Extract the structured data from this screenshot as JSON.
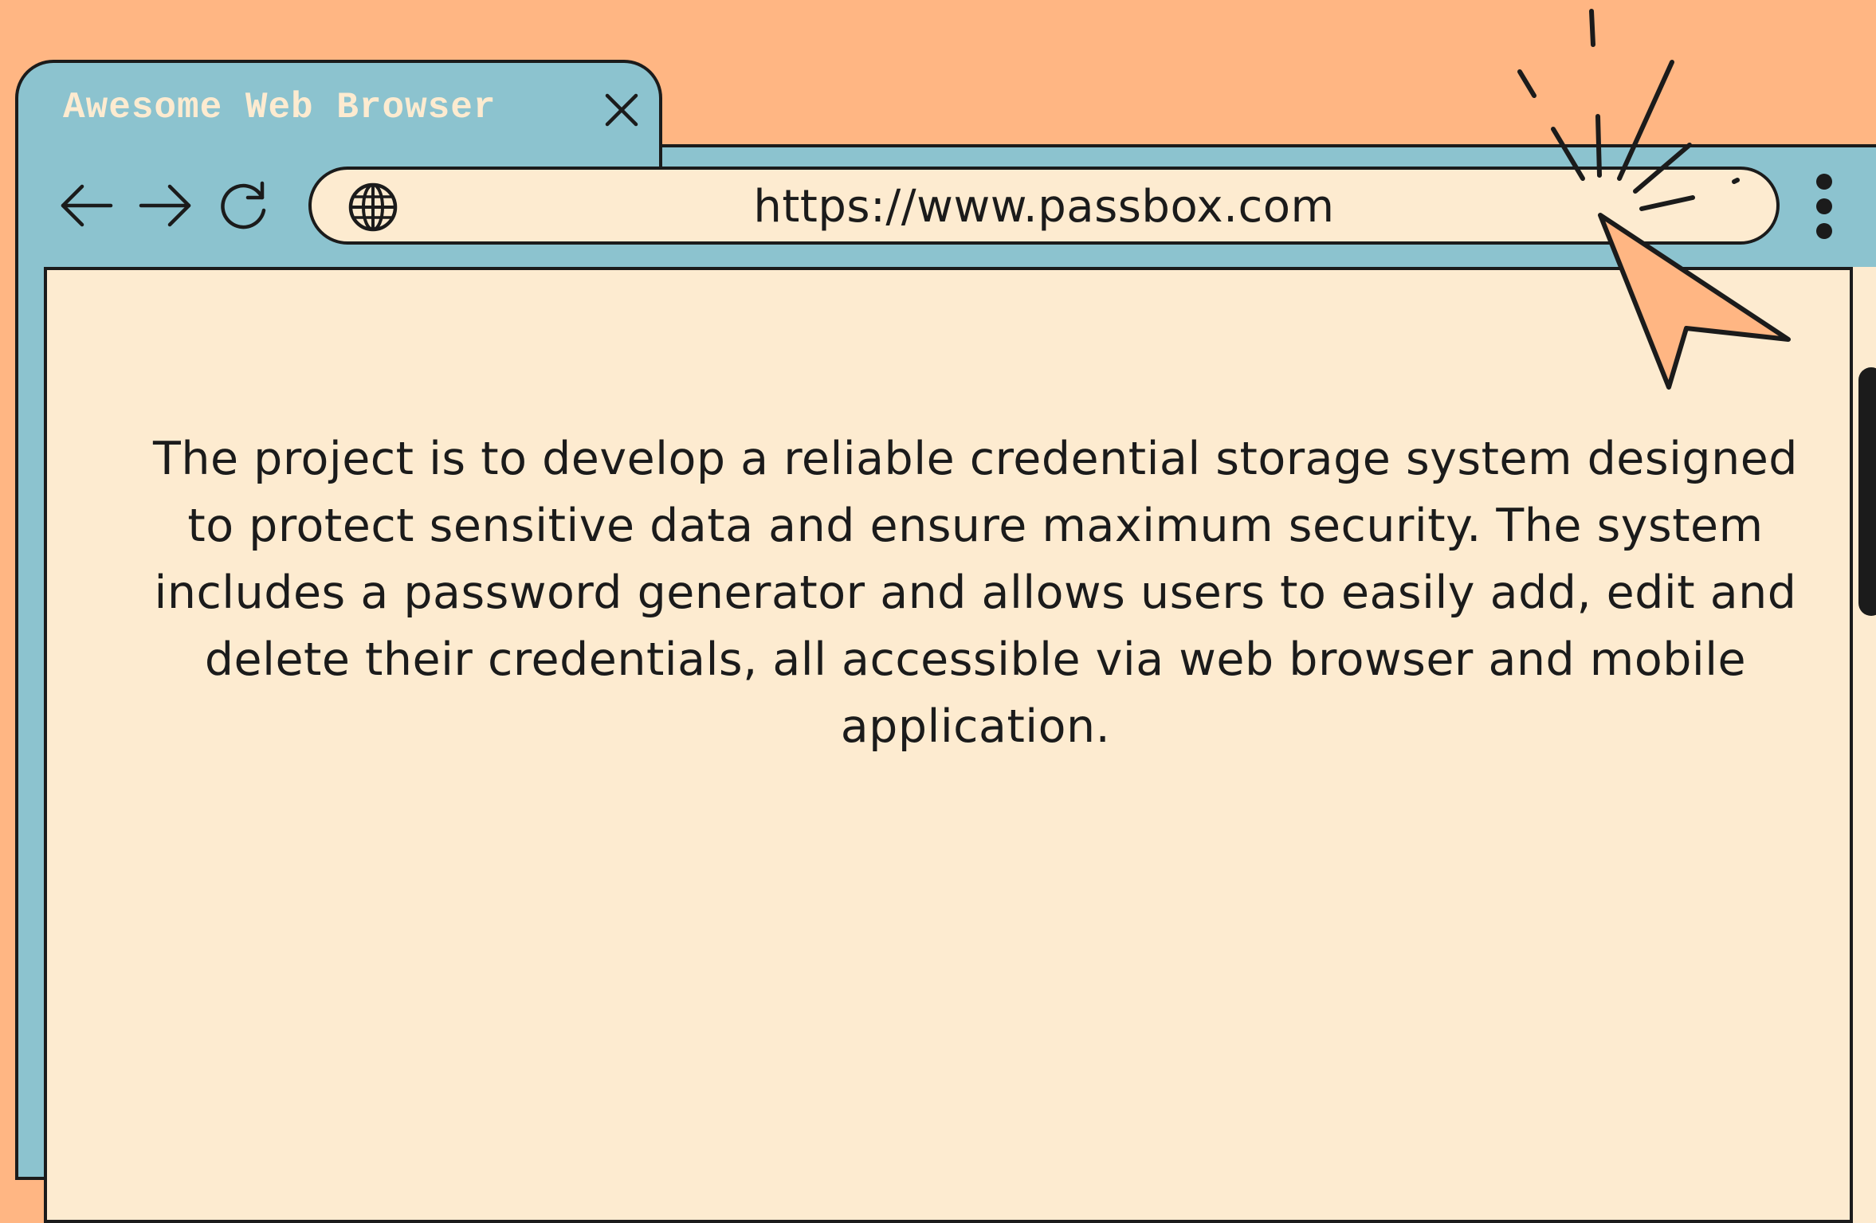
{
  "window": {
    "tab_title": "Awesome Web Browser"
  },
  "toolbar": {
    "url": "https://www.passbox.com"
  },
  "page": {
    "description": "The project is to develop a reliable credential storage system designed to protect sensitive data and ensure maximum security. The system includes a password generator and allows users to easily add, edit and delete their credentials, all accessible via web browser and mobile application."
  },
  "icons": {
    "close": "close-icon",
    "back": "arrow-left-icon",
    "forward": "arrow-right-icon",
    "reload": "reload-icon",
    "globe": "globe-icon",
    "menu": "kebab-menu-icon",
    "cursor": "mouse-pointer-icon"
  },
  "colors": {
    "background": "#FFB683",
    "chrome": "#8CC3CF",
    "page": "#FDEBD0",
    "ink": "#1B1B1B",
    "tab_text": "#FDEBD0",
    "cursor_fill": "#FFB683"
  }
}
